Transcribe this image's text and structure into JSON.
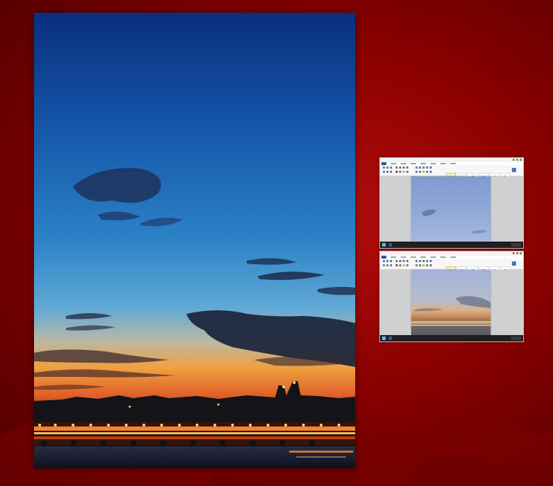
{
  "window": {
    "title": "",
    "colors": {
      "background": "#8a0000",
      "sky_top": "#0b3a8c",
      "sky_mid": "#3a86c8",
      "horizon": "#f08a2a",
      "lights": "#ffb347"
    }
  },
  "poster": {
    "image": "city-bridge-sunset-sky"
  },
  "thumbnails": [
    {
      "app": "word-processor",
      "ribbon_tabs": [
        "FILE",
        "HOME",
        "INSERT",
        "DESIGN",
        "LAYOUT",
        "REFERENCES",
        "MAILINGS",
        "REVIEW",
        "VIEW"
      ],
      "styles": [
        "AaBbCcD",
        "AaBbCcD",
        "AaBb",
        "AaBbC",
        "AaBbC",
        "AaBbC"
      ],
      "page_image": "sky-top-section"
    },
    {
      "app": "word-processor",
      "ribbon_tabs": [
        "FILE",
        "HOME",
        "INSERT",
        "DESIGN",
        "LAYOUT",
        "REFERENCES",
        "MAILINGS",
        "REVIEW",
        "VIEW"
      ],
      "styles": [
        "AaBbCcD",
        "AaBbCcD",
        "AaBb",
        "AaBbC",
        "AaBbC",
        "AaBbC"
      ],
      "page_image": "sky-bottom-section"
    }
  ]
}
